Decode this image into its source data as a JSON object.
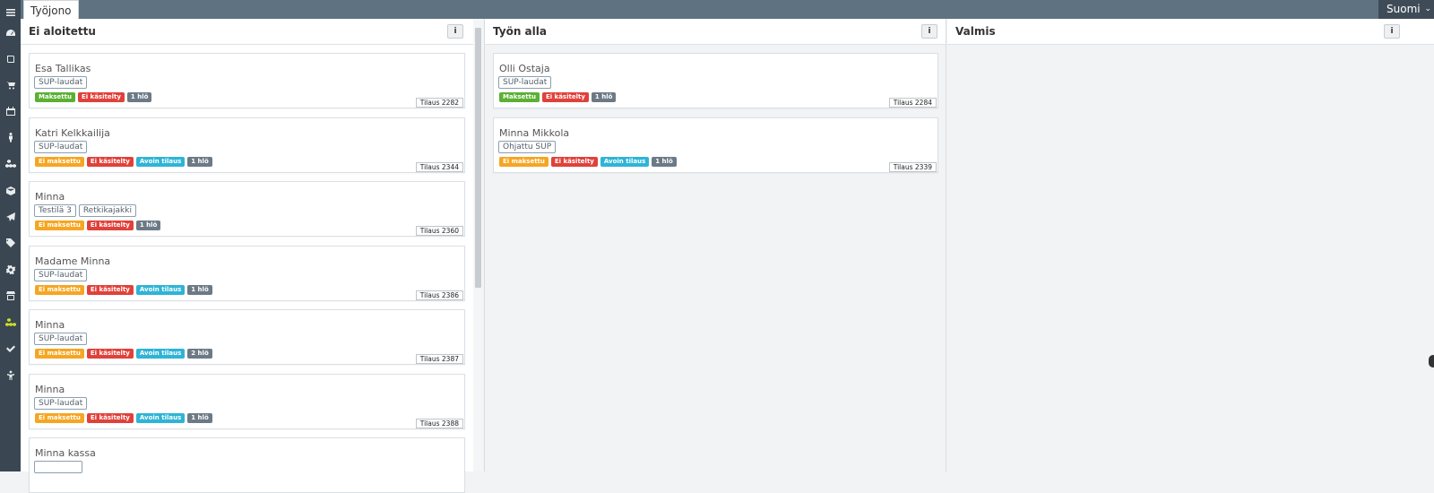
{
  "topbar": {
    "tab_label": "Työjono",
    "language": "Suomi",
    "language_chevron": "⌄"
  },
  "sidebar": {
    "items": [
      {
        "icon": "menu-icon"
      },
      {
        "icon": "dashboard-icon"
      },
      {
        "icon": "book-icon"
      },
      {
        "icon": "cart-icon"
      },
      {
        "icon": "calendar-icon"
      },
      {
        "icon": "person-icon"
      },
      {
        "icon": "cubes-icon"
      },
      {
        "icon": "box-icon"
      },
      {
        "icon": "send-icon"
      },
      {
        "icon": "tag-icon"
      },
      {
        "icon": "gear-icon"
      },
      {
        "icon": "shop-icon"
      },
      {
        "icon": "worklist-icon"
      },
      {
        "icon": "check-icon"
      },
      {
        "icon": "child-icon"
      }
    ]
  },
  "columns": [
    {
      "title": "Ei aloitettu",
      "info": "i"
    },
    {
      "title": "Työn alla",
      "info": "i"
    },
    {
      "title": "Valmis",
      "info": "i"
    }
  ],
  "cards_not_started": [
    {
      "name": "Esa Tallikas",
      "chips": [
        "SUP-laudat"
      ],
      "badges": [
        [
          "Maksettu",
          "paid"
        ],
        [
          "Ei käsitelty",
          "red"
        ],
        [
          "1 hlö",
          "gray"
        ]
      ],
      "order": "Tilaus 2282"
    },
    {
      "name": "Katri Kelkkailija",
      "chips": [
        "SUP-laudat"
      ],
      "badges": [
        [
          "Ei maksettu",
          "unpaid"
        ],
        [
          "Ei käsitelty",
          "red"
        ],
        [
          "Avoin tilaus",
          "open"
        ],
        [
          "1 hlö",
          "gray"
        ]
      ],
      "order": "Tilaus 2344"
    },
    {
      "name": "Minna",
      "chips": [
        "Testilä 3",
        "Retkikajakki"
      ],
      "badges": [
        [
          "Ei maksettu",
          "unpaid"
        ],
        [
          "Ei käsitelty",
          "red"
        ],
        [
          "1 hlö",
          "gray"
        ]
      ],
      "order": "Tilaus 2360"
    },
    {
      "name": "Madame Minna",
      "chips": [
        "SUP-laudat"
      ],
      "badges": [
        [
          "Ei maksettu",
          "unpaid"
        ],
        [
          "Ei käsitelty",
          "red"
        ],
        [
          "Avoin tilaus",
          "open"
        ],
        [
          "1 hlö",
          "gray"
        ]
      ],
      "order": "Tilaus 2386"
    },
    {
      "name": "Minna",
      "chips": [
        "SUP-laudat"
      ],
      "badges": [
        [
          "Ei maksettu",
          "unpaid"
        ],
        [
          "Ei käsitelty",
          "red"
        ],
        [
          "Avoin tilaus",
          "open"
        ],
        [
          "2 hlö",
          "gray"
        ]
      ],
      "order": "Tilaus 2387"
    },
    {
      "name": "Minna",
      "chips": [
        "SUP-laudat"
      ],
      "badges": [
        [
          "Ei maksettu",
          "unpaid"
        ],
        [
          "Ei käsitelty",
          "red"
        ],
        [
          "Avoin tilaus",
          "open"
        ],
        [
          "1 hlö",
          "gray"
        ]
      ],
      "order": "Tilaus 2388"
    },
    {
      "name": "Minna kassa",
      "chips": [],
      "badges": [],
      "order": ""
    }
  ],
  "cards_in_progress": [
    {
      "name": "Olli Ostaja",
      "chips": [
        "SUP-laudat"
      ],
      "badges": [
        [
          "Maksettu",
          "paid"
        ],
        [
          "Ei käsitelty",
          "red"
        ],
        [
          "1 hlö",
          "gray"
        ]
      ],
      "order": "Tilaus 2284"
    },
    {
      "name": "Minna Mikkola",
      "chips": [
        "Ohjattu SUP"
      ],
      "badges": [
        [
          "Ei maksettu",
          "unpaid"
        ],
        [
          "Ei käsitelty",
          "red"
        ],
        [
          "Avoin tilaus",
          "open"
        ],
        [
          "1 hlö",
          "gray"
        ]
      ],
      "order": "Tilaus 2339"
    }
  ],
  "colors": {
    "sidebar": "#3a4651",
    "topbar": "#5f7282",
    "active_icon": "#c8dd2a",
    "paid": "#5cb034",
    "unpaid": "#f5a623",
    "not_handled": "#e0413b",
    "open_order": "#2fb4d6",
    "persons": "#6c7a86"
  }
}
